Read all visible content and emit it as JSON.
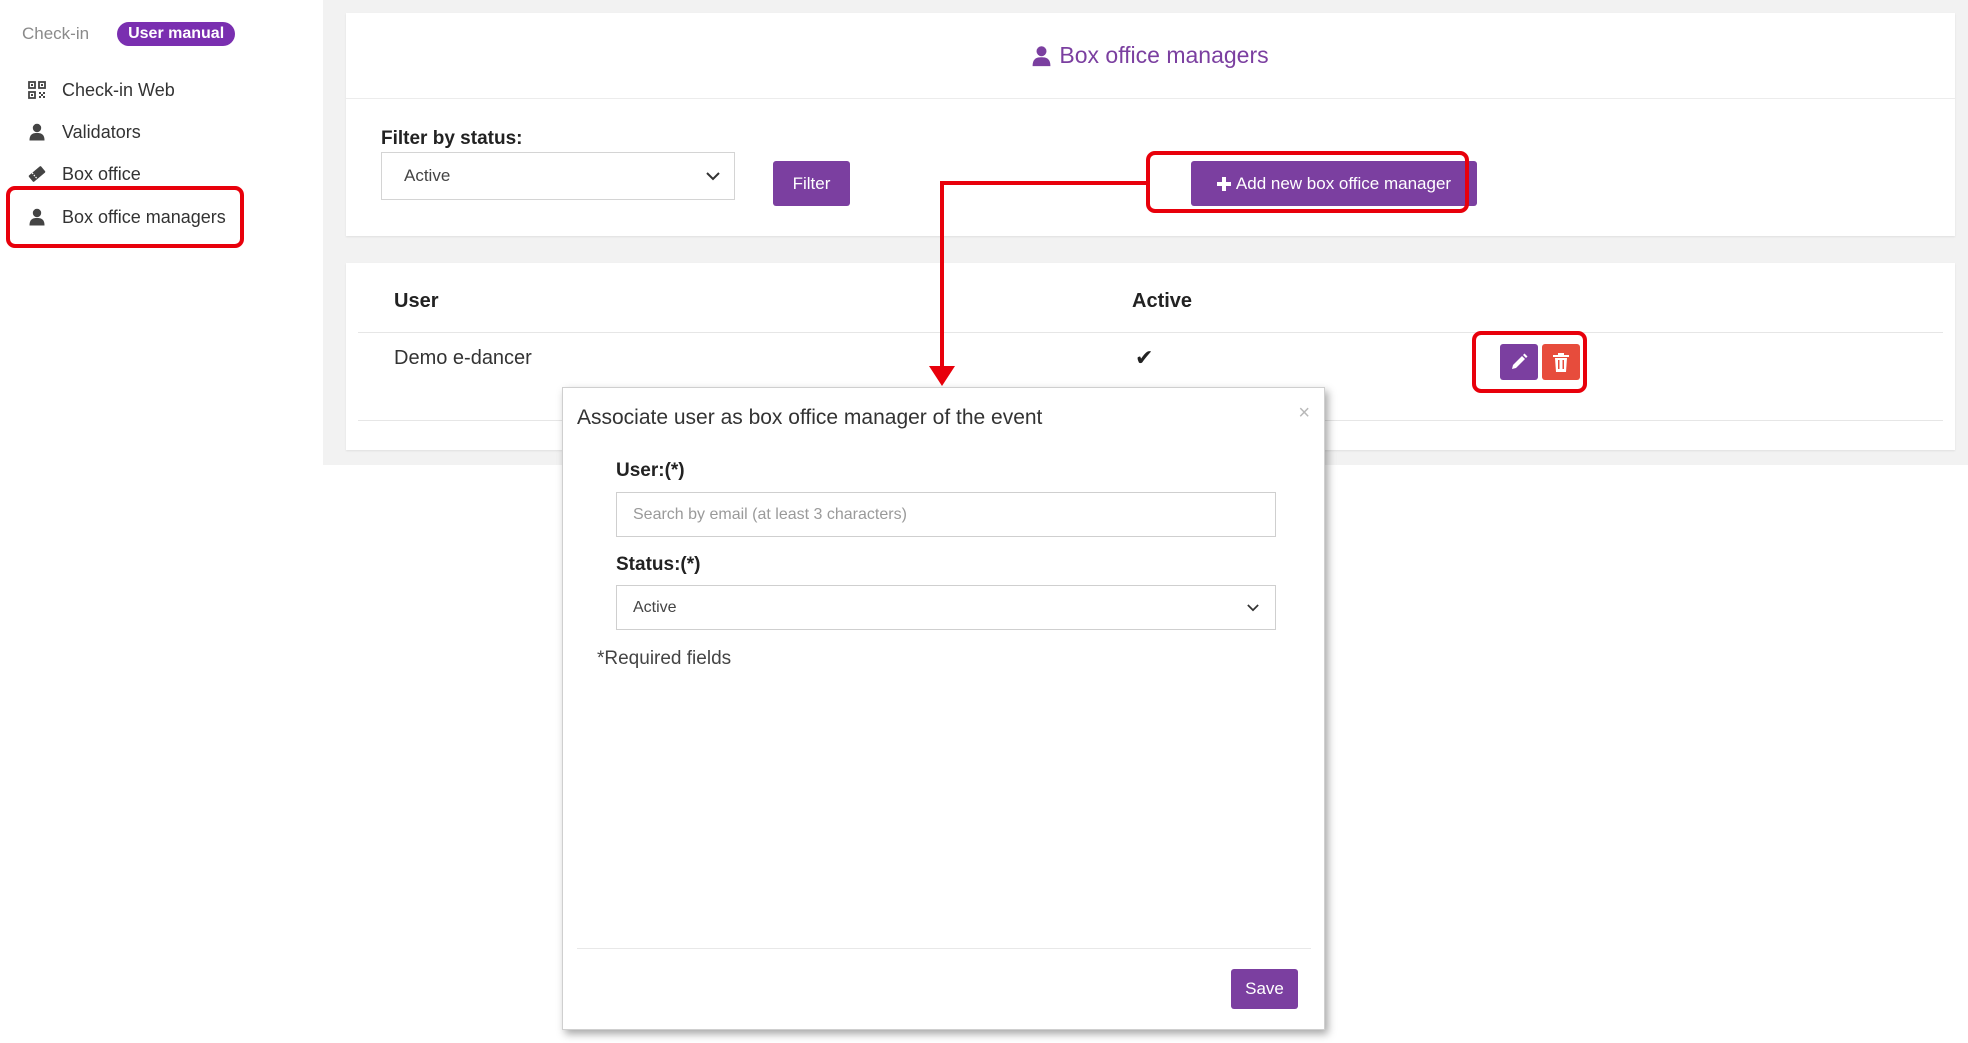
{
  "sidebar": {
    "section_label": "Check-in",
    "manual_badge": "User manual",
    "items": [
      {
        "label": "Check-in Web",
        "icon": "qr-code-icon"
      },
      {
        "label": "Validators",
        "icon": "user-icon"
      },
      {
        "label": "Box office",
        "icon": "ticket-icon"
      },
      {
        "label": "Box office managers",
        "icon": "user-icon"
      }
    ]
  },
  "page": {
    "title": "Box office managers",
    "filter_label": "Filter by status:",
    "filter_value": "Active",
    "filter_button": "Filter",
    "add_button": "Add new box office manager"
  },
  "table": {
    "headers": [
      "User",
      "Active"
    ],
    "rows": [
      {
        "user": "Demo e-dancer",
        "active": "✔"
      }
    ]
  },
  "modal": {
    "title": "Associate user as box office manager of the event",
    "close": "×",
    "user_label": "User:(*)",
    "user_placeholder": "Search by email (at least 3 characters)",
    "status_label": "Status:(*)",
    "status_value": "Active",
    "required_note": "*Required fields",
    "save_button": "Save"
  },
  "colors": {
    "accent": "#7b3fa0",
    "badge": "#7a2fb0",
    "danger": "#e74c3c",
    "highlight": "#e8000b"
  }
}
